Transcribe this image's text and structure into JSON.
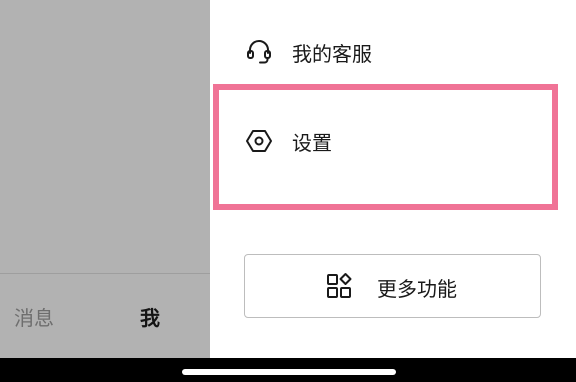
{
  "tabbar": {
    "messages_label": "消息",
    "me_label": "我"
  },
  "drawer": {
    "items": [
      {
        "label": "我的客服",
        "icon": "headset-icon"
      },
      {
        "label": "设置",
        "icon": "settings-hexagon-icon"
      }
    ],
    "more_button": {
      "label": "更多功能",
      "icon": "grid-apps-icon"
    }
  },
  "colors": {
    "highlight": "#f07396",
    "backdrop": "#b2b2b2"
  }
}
